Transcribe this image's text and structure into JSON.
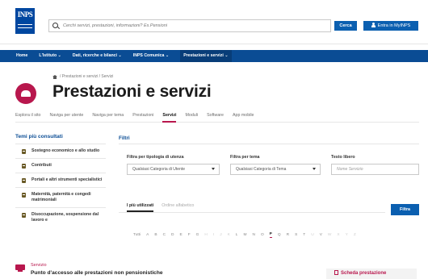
{
  "brand": {
    "logo_text": "INPS",
    "accent": "#0a4c94",
    "highlight": "#b8174d"
  },
  "header": {
    "search_placeholder": "Cerchi servizi, prestazioni, informazioni? Es.Pensioni",
    "search_button": "Cerca",
    "login_button": "Entra in MyINPS"
  },
  "nav": {
    "items": [
      {
        "label": "Home"
      },
      {
        "label": "L'Istituto ⌄"
      },
      {
        "label": "Dati, ricerche e bilanci ⌄"
      },
      {
        "label": "INPS Comunica ⌄"
      },
      {
        "label": "Prestazioni e servizi ⌄"
      }
    ]
  },
  "page": {
    "breadcrumb": "/ Prestazioni e servizi / Servizi",
    "title": "Prestazioni e servizi",
    "tabs": [
      {
        "label": "Esplora il sito"
      },
      {
        "label": "Naviga per utente"
      },
      {
        "label": "Naviga per tema"
      },
      {
        "label": "Prestazioni"
      },
      {
        "label": "Servizi"
      },
      {
        "label": "Moduli"
      },
      {
        "label": "Software"
      },
      {
        "label": "App mobile"
      }
    ],
    "active_tab": "Servizi"
  },
  "sidebar": {
    "title": "Temi più consultati",
    "items": [
      {
        "label": "Sostegno economico e allo studio"
      },
      {
        "label": "Contributi"
      },
      {
        "label": "Portali e altri strumenti specialistici"
      },
      {
        "label": "Maternità, paternità e congedi matrimoniali"
      },
      {
        "label": "Disoccupazione, sospensione dal lavoro e"
      }
    ]
  },
  "filters": {
    "title": "Filtri",
    "user_type": {
      "label": "Filtra per tipologia di utenza",
      "value": "Qualsiasi Categoria di Utente"
    },
    "theme": {
      "label": "Filtra per tema",
      "value": "Qualsiasi Categoria di Tema"
    },
    "free_text": {
      "label": "Testo libero",
      "placeholder": "Nome Servizio"
    },
    "button": "Filtra"
  },
  "view_tabs": {
    "items": [
      {
        "label": "I più utilizzati"
      },
      {
        "label": "Ordine alfabetico"
      }
    ],
    "active": "I più utilizzati"
  },
  "alphabet": {
    "all_label": "Tutti",
    "letters": [
      "A",
      "B",
      "C",
      "D",
      "E",
      "F",
      "G",
      "H",
      "I",
      "J",
      "K",
      "L",
      "M",
      "N",
      "O",
      "P",
      "Q",
      "R",
      "S",
      "T",
      "U",
      "V",
      "W",
      "X",
      "Y",
      "Z"
    ],
    "selected": "P",
    "faded": [
      "H",
      "I",
      "J",
      "K",
      "U",
      "W",
      "X",
      "Y",
      "Z"
    ]
  },
  "result": {
    "type_label": "Servizio",
    "title": "Punto d'accesso alle prestazioni non pensionistiche",
    "link_label": "Scheda prestazione"
  }
}
